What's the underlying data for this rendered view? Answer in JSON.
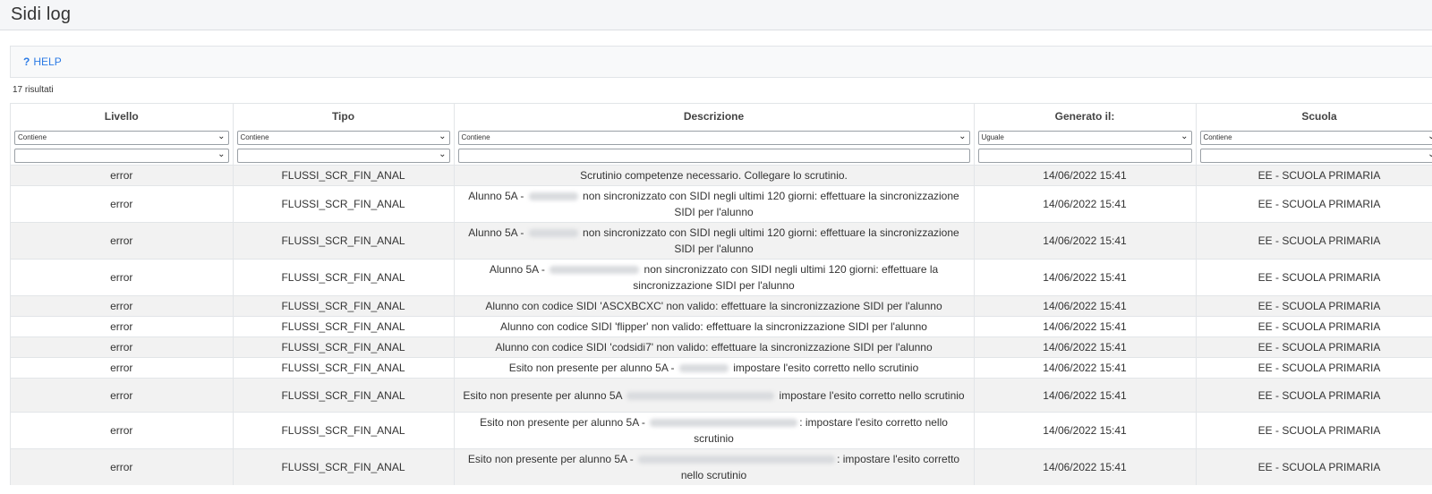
{
  "page": {
    "title": "Sidi log"
  },
  "help": {
    "label": "HELP",
    "icon": "?"
  },
  "results_text": "17 risultati",
  "columns": [
    {
      "header": "Livello",
      "filter_mode": "Contiene"
    },
    {
      "header": "Tipo",
      "filter_mode": "Contiene"
    },
    {
      "header": "Descrizione",
      "filter_mode": "Contiene"
    },
    {
      "header": "Generato il:",
      "filter_mode": "Uguale"
    },
    {
      "header": "Scuola",
      "filter_mode": "Contiene"
    }
  ],
  "rows": [
    {
      "livello": "error",
      "tipo": "FLUSSI_SCR_FIN_ANAL",
      "desc_before": "Scrutinio competenze necessario. Collegare lo scrutinio.",
      "desc_after": "",
      "blur": 0,
      "generato": "14/06/2022 15:41",
      "scuola": "EE - SCUOLA PRIMARIA",
      "h": 20
    },
    {
      "livello": "error",
      "tipo": "FLUSSI_SCR_FIN_ANAL",
      "desc_before": "Alunno 5A - ",
      "desc_after": " non sincronizzato con SIDI negli ultimi 120 giorni: effettuare la sincronizzazione SIDI per l'alunno",
      "blur": 55,
      "generato": "14/06/2022 15:41",
      "scuola": "EE - SCUOLA PRIMARIA",
      "h": 38
    },
    {
      "livello": "error",
      "tipo": "FLUSSI_SCR_FIN_ANAL",
      "desc_before": "Alunno 5A - ",
      "desc_after": " non sincronizzato con SIDI negli ultimi 120 giorni: effettuare la sincronizzazione SIDI per l'alunno",
      "blur": 55,
      "generato": "14/06/2022 15:41",
      "scuola": "EE - SCUOLA PRIMARIA",
      "h": 38
    },
    {
      "livello": "error",
      "tipo": "FLUSSI_SCR_FIN_ANAL",
      "desc_before": "Alunno 5A - ",
      "desc_after": " non sincronizzato con SIDI negli ultimi 120 giorni: effettuare la sincronizzazione SIDI per l'alunno",
      "blur": 100,
      "generato": "14/06/2022 15:41",
      "scuola": "EE - SCUOLA PRIMARIA",
      "h": 38
    },
    {
      "livello": "error",
      "tipo": "FLUSSI_SCR_FIN_ANAL",
      "desc_before": "Alunno con codice SIDI 'ASCXBCXC' non valido: effettuare la sincronizzazione SIDI per l'alunno",
      "desc_after": "",
      "blur": 0,
      "generato": "14/06/2022 15:41",
      "scuola": "EE - SCUOLA PRIMARIA",
      "h": 20
    },
    {
      "livello": "error",
      "tipo": "FLUSSI_SCR_FIN_ANAL",
      "desc_before": "Alunno con codice SIDI 'flipper' non valido: effettuare la sincronizzazione SIDI per l'alunno",
      "desc_after": "",
      "blur": 0,
      "generato": "14/06/2022 15:41",
      "scuola": "EE - SCUOLA PRIMARIA",
      "h": 20
    },
    {
      "livello": "error",
      "tipo": "FLUSSI_SCR_FIN_ANAL",
      "desc_before": "Alunno con codice SIDI 'codsidi7' non valido: effettuare la sincronizzazione SIDI per l'alunno",
      "desc_after": "",
      "blur": 0,
      "generato": "14/06/2022 15:41",
      "scuola": "EE - SCUOLA PRIMARIA",
      "h": 20
    },
    {
      "livello": "error",
      "tipo": "FLUSSI_SCR_FIN_ANAL",
      "desc_before": "Esito non presente per alunno 5A - ",
      "desc_after": " impostare l'esito corretto nello scrutinio",
      "blur": 55,
      "generato": "14/06/2022 15:41",
      "scuola": "EE - SCUOLA PRIMARIA",
      "h": 20
    },
    {
      "livello": "error",
      "tipo": "FLUSSI_SCR_FIN_ANAL",
      "desc_before": "Esito non presente per alunno 5A ",
      "desc_after": " impostare l'esito corretto nello scrutinio",
      "blur": 165,
      "generato": "14/06/2022 15:41",
      "scuola": "EE - SCUOLA PRIMARIA",
      "h": 38
    },
    {
      "livello": "error",
      "tipo": "FLUSSI_SCR_FIN_ANAL",
      "desc_before": "Esito non presente per alunno 5A - ",
      "desc_after": ": impostare l'esito corretto nello scrutinio",
      "blur": 165,
      "generato": "14/06/2022 15:41",
      "scuola": "EE - SCUOLA PRIMARIA",
      "h": 38
    },
    {
      "livello": "error",
      "tipo": "FLUSSI_SCR_FIN_ANAL",
      "desc_before": "Esito non presente per alunno 5A - ",
      "desc_after": ": impostare l'esito corretto nello scrutinio",
      "blur": 220,
      "generato": "14/06/2022 15:41",
      "scuola": "EE - SCUOLA PRIMARIA",
      "h": 38
    }
  ]
}
